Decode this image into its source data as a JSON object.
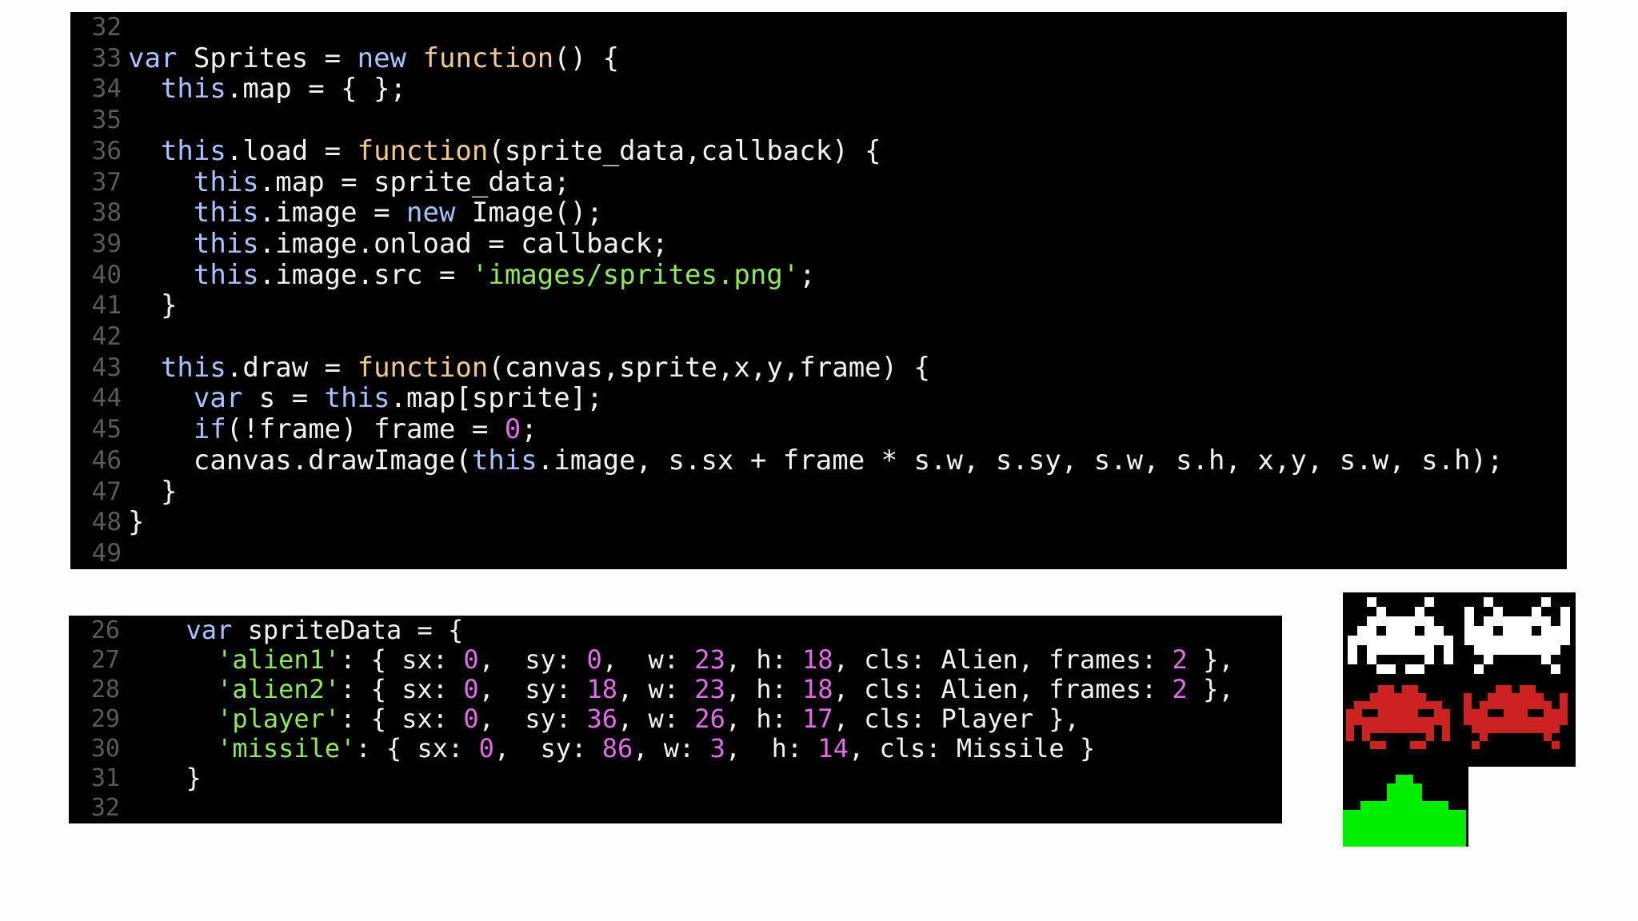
{
  "top_editor": {
    "lines": [
      {
        "n": "32",
        "tokens": []
      },
      {
        "n": "33",
        "tokens": [
          {
            "t": "var",
            "c": "th"
          },
          {
            "t": " Sprites = ",
            "c": "pl"
          },
          {
            "t": "new",
            "c": "th"
          },
          {
            "t": " ",
            "c": "pl"
          },
          {
            "t": "function",
            "c": "kw"
          },
          {
            "t": "() {",
            "c": "pl"
          }
        ]
      },
      {
        "n": "34",
        "tokens": [
          {
            "t": "  ",
            "c": "pl"
          },
          {
            "t": "this",
            "c": "th"
          },
          {
            "t": ".map = { };",
            "c": "pl"
          }
        ]
      },
      {
        "n": "35",
        "tokens": []
      },
      {
        "n": "36",
        "tokens": [
          {
            "t": "  ",
            "c": "pl"
          },
          {
            "t": "this",
            "c": "th"
          },
          {
            "t": ".load = ",
            "c": "pl"
          },
          {
            "t": "function",
            "c": "kw"
          },
          {
            "t": "(sprite_data,callback) {",
            "c": "pl"
          }
        ]
      },
      {
        "n": "37",
        "tokens": [
          {
            "t": "    ",
            "c": "pl"
          },
          {
            "t": "this",
            "c": "th"
          },
          {
            "t": ".map = sprite_data;",
            "c": "pl"
          }
        ]
      },
      {
        "n": "38",
        "tokens": [
          {
            "t": "    ",
            "c": "pl"
          },
          {
            "t": "this",
            "c": "th"
          },
          {
            "t": ".image = ",
            "c": "pl"
          },
          {
            "t": "new",
            "c": "th"
          },
          {
            "t": " Image();",
            "c": "pl"
          }
        ]
      },
      {
        "n": "39",
        "tokens": [
          {
            "t": "    ",
            "c": "pl"
          },
          {
            "t": "this",
            "c": "th"
          },
          {
            "t": ".image.onload = callback;",
            "c": "pl"
          }
        ]
      },
      {
        "n": "40",
        "tokens": [
          {
            "t": "    ",
            "c": "pl"
          },
          {
            "t": "this",
            "c": "th"
          },
          {
            "t": ".image.src = ",
            "c": "pl"
          },
          {
            "t": "'images/sprites.png'",
            "c": "str"
          },
          {
            "t": ";",
            "c": "pl"
          }
        ]
      },
      {
        "n": "41",
        "tokens": [
          {
            "t": "  }",
            "c": "pl"
          }
        ]
      },
      {
        "n": "42",
        "tokens": []
      },
      {
        "n": "43",
        "tokens": [
          {
            "t": "  ",
            "c": "pl"
          },
          {
            "t": "this",
            "c": "th"
          },
          {
            "t": ".draw = ",
            "c": "pl"
          },
          {
            "t": "function",
            "c": "kw"
          },
          {
            "t": "(canvas,sprite,x,y,frame) {",
            "c": "pl"
          }
        ]
      },
      {
        "n": "44",
        "tokens": [
          {
            "t": "    ",
            "c": "pl"
          },
          {
            "t": "var",
            "c": "th"
          },
          {
            "t": " s = ",
            "c": "pl"
          },
          {
            "t": "this",
            "c": "th"
          },
          {
            "t": ".map[sprite];",
            "c": "pl"
          }
        ]
      },
      {
        "n": "45",
        "tokens": [
          {
            "t": "    ",
            "c": "pl"
          },
          {
            "t": "if",
            "c": "th"
          },
          {
            "t": "(!frame) frame = ",
            "c": "pl"
          },
          {
            "t": "0",
            "c": "num"
          },
          {
            "t": ";",
            "c": "pl"
          }
        ]
      },
      {
        "n": "46",
        "tokens": [
          {
            "t": "    canvas.drawImage(",
            "c": "pl"
          },
          {
            "t": "this",
            "c": "th"
          },
          {
            "t": ".image, s.sx + frame * s.w, s.sy, s.w, s.h, x,y, s.w, s.h);",
            "c": "pl"
          }
        ]
      },
      {
        "n": "47",
        "tokens": [
          {
            "t": "  }",
            "c": "pl"
          }
        ]
      },
      {
        "n": "48",
        "tokens": [
          {
            "t": "}",
            "c": "pl"
          }
        ]
      },
      {
        "n": "49",
        "tokens": []
      }
    ]
  },
  "bottom_editor": {
    "lines": [
      {
        "n": "26",
        "tokens": [
          {
            "t": "  ",
            "c": "pl"
          },
          {
            "t": "var",
            "c": "th"
          },
          {
            "t": " spriteData = {",
            "c": "pl"
          }
        ]
      },
      {
        "n": "27",
        "tokens": [
          {
            "t": "    ",
            "c": "pl"
          },
          {
            "t": "'alien1'",
            "c": "str"
          },
          {
            "t": ": { sx: ",
            "c": "pl"
          },
          {
            "t": "0",
            "c": "num"
          },
          {
            "t": ",  sy: ",
            "c": "pl"
          },
          {
            "t": "0",
            "c": "num"
          },
          {
            "t": ",  w: ",
            "c": "pl"
          },
          {
            "t": "23",
            "c": "num"
          },
          {
            "t": ", h: ",
            "c": "pl"
          },
          {
            "t": "18",
            "c": "num"
          },
          {
            "t": ", cls: Alien, frames: ",
            "c": "pl"
          },
          {
            "t": "2",
            "c": "num"
          },
          {
            "t": " },",
            "c": "pl"
          }
        ]
      },
      {
        "n": "28",
        "tokens": [
          {
            "t": "    ",
            "c": "pl"
          },
          {
            "t": "'alien2'",
            "c": "str"
          },
          {
            "t": ": { sx: ",
            "c": "pl"
          },
          {
            "t": "0",
            "c": "num"
          },
          {
            "t": ",  sy: ",
            "c": "pl"
          },
          {
            "t": "18",
            "c": "num"
          },
          {
            "t": ", w: ",
            "c": "pl"
          },
          {
            "t": "23",
            "c": "num"
          },
          {
            "t": ", h: ",
            "c": "pl"
          },
          {
            "t": "18",
            "c": "num"
          },
          {
            "t": ", cls: Alien, frames: ",
            "c": "pl"
          },
          {
            "t": "2",
            "c": "num"
          },
          {
            "t": " },",
            "c": "pl"
          }
        ]
      },
      {
        "n": "29",
        "tokens": [
          {
            "t": "    ",
            "c": "pl"
          },
          {
            "t": "'player'",
            "c": "str"
          },
          {
            "t": ": { sx: ",
            "c": "pl"
          },
          {
            "t": "0",
            "c": "num"
          },
          {
            "t": ",  sy: ",
            "c": "pl"
          },
          {
            "t": "36",
            "c": "num"
          },
          {
            "t": ", w: ",
            "c": "pl"
          },
          {
            "t": "26",
            "c": "num"
          },
          {
            "t": ", h: ",
            "c": "pl"
          },
          {
            "t": "17",
            "c": "num"
          },
          {
            "t": ", cls: Player },",
            "c": "pl"
          }
        ]
      },
      {
        "n": "30",
        "tokens": [
          {
            "t": "    ",
            "c": "pl"
          },
          {
            "t": "'missile'",
            "c": "str"
          },
          {
            "t": ": { sx: ",
            "c": "pl"
          },
          {
            "t": "0",
            "c": "num"
          },
          {
            "t": ",  sy: ",
            "c": "pl"
          },
          {
            "t": "86",
            "c": "num"
          },
          {
            "t": ", w: ",
            "c": "pl"
          },
          {
            "t": "3",
            "c": "num"
          },
          {
            "t": ",  h: ",
            "c": "pl"
          },
          {
            "t": "14",
            "c": "num"
          },
          {
            "t": ", cls: Missile }",
            "c": "pl"
          }
        ]
      },
      {
        "n": "31",
        "tokens": [
          {
            "t": "  }",
            "c": "pl"
          }
        ]
      },
      {
        "n": "32",
        "tokens": []
      }
    ]
  },
  "colors": {
    "editor_bg": "#000000",
    "line_number": "#5a5a5a",
    "text": "#f2f2f2",
    "keyword_function": "#f0c990",
    "keyword_this": "#a8c2ff",
    "string": "#8ee85a",
    "number": "#e36be9",
    "alien1": "#ffffff",
    "alien2": "#cc2222",
    "player": "#00ee00"
  },
  "sprite_sheet": {
    "sprites": [
      "alien1-frame1",
      "alien1-frame2",
      "alien2-frame1",
      "alien2-frame2",
      "player"
    ]
  }
}
